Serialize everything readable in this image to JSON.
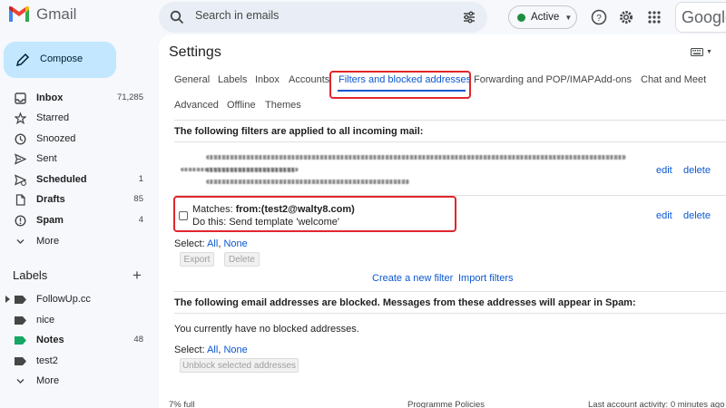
{
  "app": {
    "name": "Gmail"
  },
  "search": {
    "placeholder": "Search in emails"
  },
  "status": {
    "label": "Active",
    "color": "#1e8e3e"
  },
  "brand": {
    "google_text": "Google"
  },
  "compose_label": "Compose",
  "sidebar": {
    "items": [
      {
        "label": "Inbox",
        "count": "71,285",
        "icon": "inbox-icon"
      },
      {
        "label": "Starred",
        "count": "",
        "icon": "star-icon"
      },
      {
        "label": "Snoozed",
        "count": "",
        "icon": "clock-icon"
      },
      {
        "label": "Sent",
        "count": "",
        "icon": "send-icon"
      },
      {
        "label": "Scheduled",
        "count": "1",
        "icon": "scheduled-icon"
      },
      {
        "label": "Drafts",
        "count": "85",
        "icon": "draft-icon"
      },
      {
        "label": "Spam",
        "count": "4",
        "icon": "spam-icon"
      },
      {
        "label": "More",
        "count": "",
        "icon": "chevron-down-icon"
      }
    ],
    "labels_title": "Labels",
    "labels": [
      {
        "label": "FollowUp.cc",
        "count": "",
        "color": "#444746"
      },
      {
        "label": "nice",
        "count": "",
        "color": "#444746"
      },
      {
        "label": "Notes",
        "count": "48",
        "color": "#16a765"
      },
      {
        "label": "test2",
        "count": "",
        "color": "#444746"
      },
      {
        "label": "More",
        "count": "",
        "color": ""
      }
    ]
  },
  "settings": {
    "title": "Settings",
    "tabs": [
      "General",
      "Labels",
      "Inbox",
      "Accounts",
      "Filters and blocked addresses",
      "Forwarding and POP/IMAP",
      "Add-ons",
      "Chat and Meet",
      "Advanced",
      "Offline",
      "Themes"
    ],
    "filters_heading": "The following filters are applied to all incoming mail:",
    "filter": {
      "matches_prefix": "Matches: ",
      "matches_value": "from:(test2@walty8.com)",
      "action": "Do this: Send template 'welcome'"
    },
    "edit_label": "edit",
    "delete_label": "delete",
    "select_label": "Select: ",
    "select_all": "All",
    "select_none": "None",
    "export_label": "Export",
    "delete_button_label": "Delete",
    "create_filter": "Create a new filter",
    "import_filters": "Import filters",
    "blocked_heading": "The following email addresses are blocked. Messages from these addresses will appear in Spam:",
    "no_blocked": "You currently have no blocked addresses.",
    "unblock_label": "Unblock selected addresses"
  },
  "footer": {
    "storage": "7% full",
    "policies": "Programme Policies",
    "activity": "Last account activity: 0 minutes ago"
  }
}
